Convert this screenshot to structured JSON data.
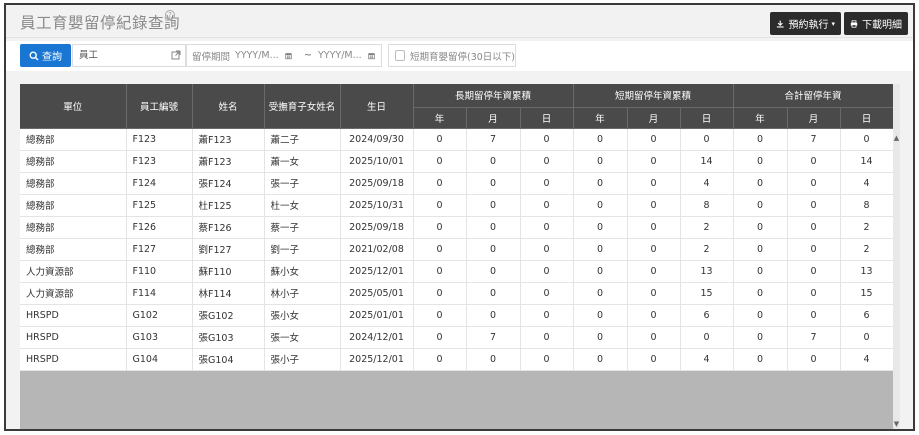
{
  "header": {
    "title": "員工育嬰留停紀錄查詢",
    "help_icon": "question-circle-icon",
    "schedule_label": "預約執行",
    "download_label": "下載明細"
  },
  "toolbar": {
    "query_label": "查詢",
    "employee_value": "員工",
    "period_label": "留停期間",
    "date_placeholder": "YYYY/M...",
    "date_separator": "~",
    "short_term_label": "短期育嬰留停(30日以下)"
  },
  "table": {
    "headers": {
      "unit": "單位",
      "employee_id": "員工編號",
      "name": "姓名",
      "child_name": "受撫育子女姓名",
      "birthday": "生日",
      "long_term": "長期留停年資累積",
      "short_term": "短期留停年資累積",
      "total": "合計留停年資",
      "year": "年",
      "month": "月",
      "day": "日"
    },
    "rows": [
      [
        "總務部",
        "F123",
        "蕭F123",
        "蕭二子",
        "2024/09/30",
        "0",
        "7",
        "0",
        "0",
        "0",
        "0",
        "0",
        "7",
        "0"
      ],
      [
        "總務部",
        "F123",
        "蕭F123",
        "蕭一女",
        "2025/10/01",
        "0",
        "0",
        "0",
        "0",
        "0",
        "14",
        "0",
        "0",
        "14"
      ],
      [
        "總務部",
        "F124",
        "張F124",
        "張一子",
        "2025/09/18",
        "0",
        "0",
        "0",
        "0",
        "0",
        "4",
        "0",
        "0",
        "4"
      ],
      [
        "總務部",
        "F125",
        "杜F125",
        "杜一女",
        "2025/10/31",
        "0",
        "0",
        "0",
        "0",
        "0",
        "8",
        "0",
        "0",
        "8"
      ],
      [
        "總務部",
        "F126",
        "蔡F126",
        "蔡一子",
        "2025/09/18",
        "0",
        "0",
        "0",
        "0",
        "0",
        "2",
        "0",
        "0",
        "2"
      ],
      [
        "總務部",
        "F127",
        "劉F127",
        "劉一子",
        "2021/02/08",
        "0",
        "0",
        "0",
        "0",
        "0",
        "2",
        "0",
        "0",
        "2"
      ],
      [
        "人力資源部",
        "F110",
        "蘇F110",
        "蘇小女",
        "2025/12/01",
        "0",
        "0",
        "0",
        "0",
        "0",
        "13",
        "0",
        "0",
        "13"
      ],
      [
        "人力資源部",
        "F114",
        "林F114",
        "林小子",
        "2025/05/01",
        "0",
        "0",
        "0",
        "0",
        "0",
        "15",
        "0",
        "0",
        "15"
      ],
      [
        "HRSPD",
        "G102",
        "張G102",
        "張小女",
        "2025/01/01",
        "0",
        "0",
        "0",
        "0",
        "0",
        "6",
        "0",
        "0",
        "6"
      ],
      [
        "HRSPD",
        "G103",
        "張G103",
        "張一女",
        "2024/12/01",
        "0",
        "7",
        "0",
        "0",
        "0",
        "0",
        "0",
        "7",
        "0"
      ],
      [
        "HRSPD",
        "G104",
        "張G104",
        "張小子",
        "2025/12/01",
        "0",
        "0",
        "0",
        "0",
        "0",
        "4",
        "0",
        "0",
        "4"
      ]
    ]
  },
  "icons": {
    "schedule": "download-arrow-icon",
    "download": "printer-icon",
    "query": "search-icon",
    "employee_lookup": "external-link-icon",
    "calendar": "calendar-icon",
    "scroll_up": "triangle-up-icon",
    "scroll_down": "triangle-down-icon"
  },
  "colors": {
    "primary": "#1976d2",
    "header_dark": "#4a4a4a",
    "button_dark": "#2b2b2b"
  }
}
